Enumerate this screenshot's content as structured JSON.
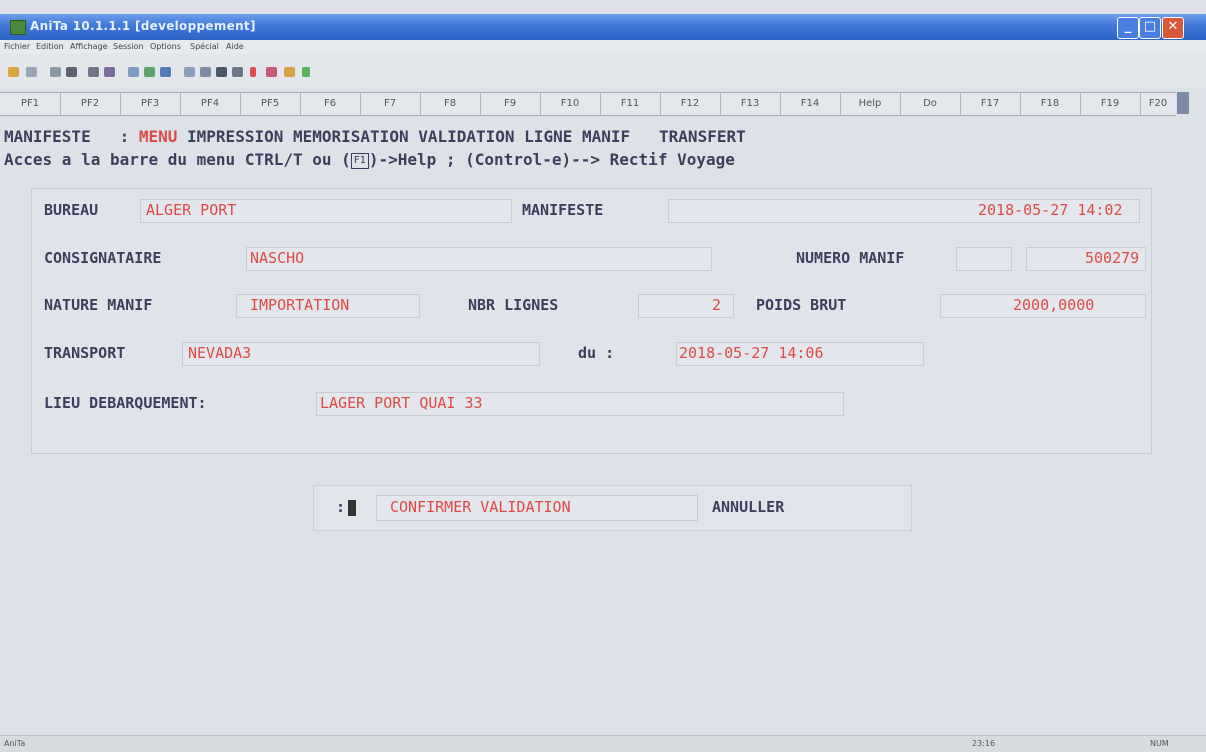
{
  "window": {
    "app_name": "AniTa",
    "title_suffix": "10.1.1.1 [developpement]",
    "minimize": "_",
    "maximize": "□",
    "close": "✕"
  },
  "menu": [
    "Fichier",
    "Edition",
    "Affichage",
    "Session",
    "Options",
    "Spécial",
    "Aide"
  ],
  "toolbar_icons": [
    "open-icon",
    "save-icon",
    "copy-icon",
    "paste-icon",
    "print-icon",
    "print-preview-icon",
    "screen-icon",
    "refresh-icon",
    "terminal-icon",
    "record-icon",
    "record-stop-icon",
    "text-icon",
    "grid-icon",
    "pointer-icon",
    "link-icon",
    "macro-icon",
    "play-icon"
  ],
  "fkeys": [
    "PF1",
    "PF2",
    "PF3",
    "PF4",
    "PF5",
    "F6",
    "F7",
    "F8",
    "F9",
    "F10",
    "F11",
    "F12",
    "F13",
    "F14",
    "Help",
    "Do",
    "F17",
    "F18",
    "F19",
    "F20"
  ],
  "screen": {
    "menu_prefix": "MANIFESTE   : ",
    "menu_active": "MENU",
    "menu_rest": " IMPRESSION MEMORISATION VALIDATION LIGNE MANIF   TRANSFERT",
    "help_prefix": "Acces a la barre du menu CTRL/T ou (",
    "help_key": "F1",
    "help_suffix": ")->Help ; (Control-e)--> Rectif Voyage",
    "bureau_label": "BUREAU",
    "bureau_value": "ALGER PORT",
    "manifeste_label": "MANIFESTE",
    "manifeste_datetime": "2018-05-27 14:02",
    "consignataire_label": "CONSIGNATAIRE",
    "consignataire_value": "NASCHO",
    "numero_manif_label": "NUMERO MANIF",
    "numero_manif_value": "500279",
    "nature_label": "NATURE MANIF",
    "nature_value": "IMPORTATION",
    "nbr_lignes_label": "NBR LIGNES",
    "nbr_lignes_value": "2",
    "poids_brut_label": "POIDS BRUT",
    "poids_brut_value": "2000,0000",
    "transport_label": "TRANSPORT",
    "transport_value": "NEVADA3",
    "du_label": "du :",
    "transport_datetime": "2018-05-27 14:06",
    "lieu_label": "LIEU DEBARQUEMENT:",
    "lieu_value": "LAGER PORT QUAI 33",
    "prompt_colon": ":",
    "confirm_label": "CONFIRMER VALIDATION",
    "cancel_label": "ANNULLER"
  },
  "status": {
    "left": "AniTa",
    "time": "23:16",
    "num": "NUM"
  },
  "colors": {
    "title_bar": "#3f78d8",
    "value_text": "#e04a44",
    "label_text": "#3d3f5c",
    "background": "#dde2e8"
  }
}
